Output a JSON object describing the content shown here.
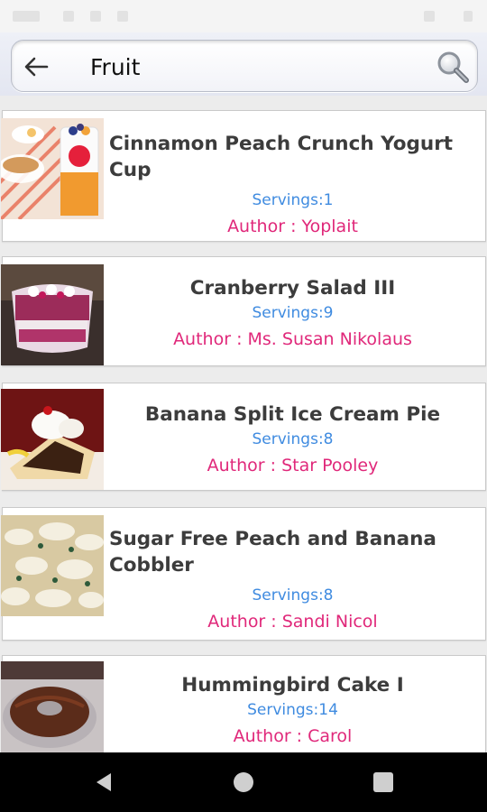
{
  "search": {
    "query": "Fruit"
  },
  "recipes": [
    {
      "title": "Cinnamon Peach Crunch Yogurt Cup",
      "servings": "Servings:1",
      "author": "Author : Yoplait"
    },
    {
      "title": "Cranberry Salad III",
      "servings": "Servings:9",
      "author": "Author : Ms. Susan Nikolaus"
    },
    {
      "title": "Banana Split Ice Cream Pie",
      "servings": "Servings:8",
      "author": "Author : Star Pooley"
    },
    {
      "title": "Sugar Free Peach and Banana Cobbler",
      "servings": "Servings:8",
      "author": "Author : Sandi Nicol"
    },
    {
      "title": "Hummingbird Cake I",
      "servings": "Servings:14",
      "author": "Author : Carol"
    }
  ],
  "colors": {
    "servings": "#3f8be0",
    "author": "#e0287a",
    "title": "#3c3c3c"
  },
  "icons": {
    "back": "arrow-left-icon",
    "search": "magnifier-icon",
    "nav_back": "triangle-back-icon",
    "nav_home": "circle-home-icon",
    "nav_recent": "square-recent-icon"
  }
}
